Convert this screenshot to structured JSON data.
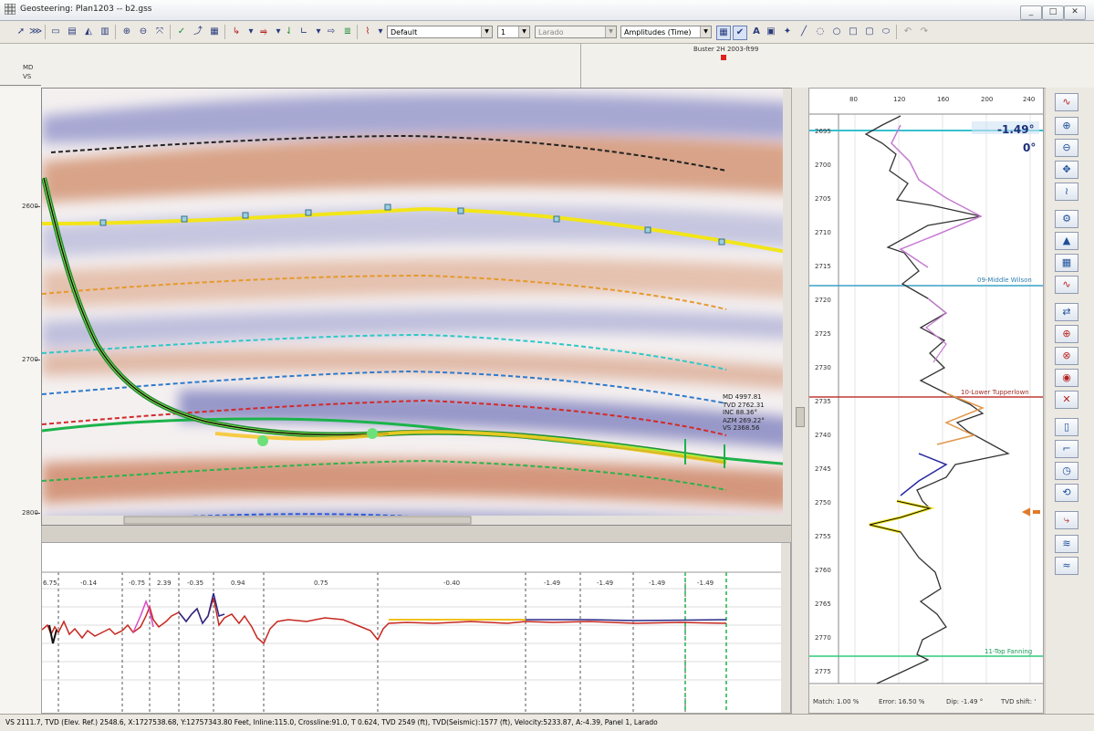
{
  "window": {
    "title": "Geosteering: Plan1203 -- b2.gss",
    "controls": [
      "_",
      "□",
      "✕"
    ]
  },
  "toolbar": {
    "combo_default": "Default",
    "combo_number": "1",
    "combo_larado": "Larado",
    "combo_amplitudes": "Amplitudes (Time)"
  },
  "header": {
    "md_label": "MD",
    "vs_label": "VS",
    "well_label": "Buster 2H 2003-ft99"
  },
  "main_panel": {
    "depth_ticks": [
      "2600",
      "2700",
      "2800"
    ],
    "readout": {
      "md": "MD 4997.81",
      "tvd": "TVD 2762.31",
      "inc": "INC 88.36°",
      "azm": "AZM 269.22°",
      "vs": "VS 2368.56"
    }
  },
  "bottom_panel": {
    "segment_labels": [
      "6.75",
      "-0.14",
      "-0.75",
      "2.39",
      "-0.35",
      "0.94",
      "0.75",
      "-0.40",
      "-1.49",
      "-1.49",
      "-1.49",
      "-1.49"
    ]
  },
  "log_panel": {
    "scale_ticks": [
      "80",
      "120",
      "160",
      "200",
      "240"
    ],
    "depth_ticks": [
      "2695",
      "2700",
      "2705",
      "2710",
      "2715",
      "2720",
      "2725",
      "2730",
      "2735",
      "2740",
      "2745",
      "2750",
      "2755",
      "2760",
      "2765",
      "2770",
      "2775"
    ],
    "dip_value": "-1.49°",
    "angle_value": "0°",
    "formations": {
      "middle_wilson": "09-Middle Wilson",
      "lower_tupperlown": "10-Lower Tupperlown",
      "top_fanning": "11-Top Fanning"
    },
    "status": {
      "match": "Match: 1.00 %",
      "error": "Error: 16.50 %",
      "dip": "Dip: -1.49 °",
      "tvd_shift": "TVD shift: '"
    }
  },
  "right_toolbar": {
    "icons": [
      "wave-log-icon",
      "zoom-in-icon",
      "zoom-out-icon",
      "pan-icon",
      "wave-flip-icon",
      "settings-icon",
      "mountain-icon",
      "grid-icon",
      "log-curve-icon",
      "swap-icon",
      "log-plus-icon",
      "log-lock-icon",
      "log-target-icon",
      "log-remove-icon",
      "column-icon",
      "step-icon",
      "clock-icon",
      "reset-icon",
      "bend-icon",
      "lines-icon",
      "wave-flat-icon"
    ]
  },
  "status_bar": {
    "text": "VS 2111.7,  TVD (Elev. Ref.) 2548.6,  X:1727538.68,  Y:12757343.80 Feet,  Inline:115.0,  Crossline:91.0,  T 0.624,  TVD 2549 (ft),  TVD(Seismic):1577 (ft),  Velocity:5233.87,  A:-4.39,  Panel 1,  Larado"
  },
  "colors": {
    "seismic_red": "#c0683f",
    "seismic_blue": "#5a5fa8",
    "horizon_yellow": "#f2e51a",
    "horizon_green": "#1bb34a",
    "formation_blue": "#39a2c8",
    "formation_red": "#c03a32",
    "formation_green": "#2ecc7a"
  }
}
